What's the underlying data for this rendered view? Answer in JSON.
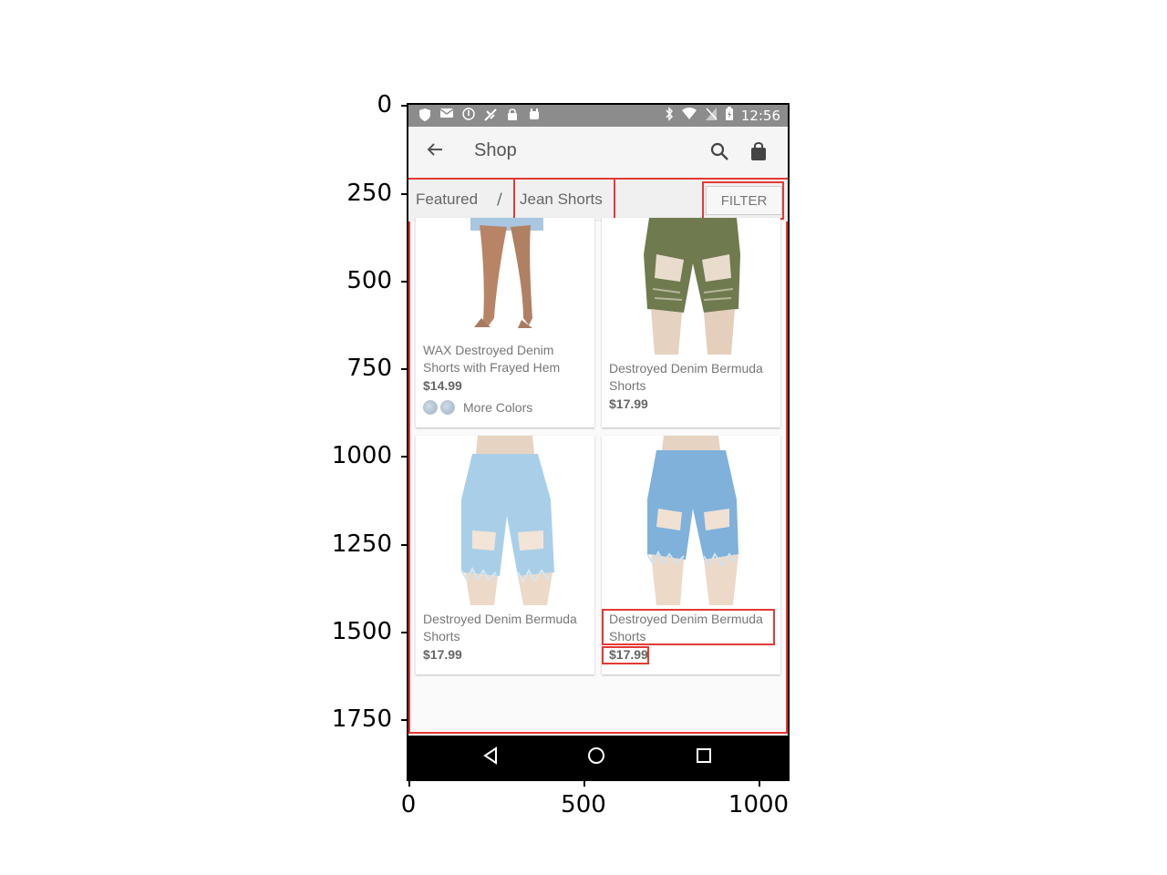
{
  "axes": {
    "y_ticks": [
      "0",
      "250",
      "500",
      "750",
      "1000",
      "1250",
      "1500",
      "1750"
    ],
    "x_ticks": [
      "0",
      "500",
      "1000"
    ]
  },
  "status_bar": {
    "time": "12:56",
    "left_icons": [
      "shield-icon",
      "email-icon",
      "info-icon",
      "sync-off-icon",
      "lock-icon",
      "android-icon"
    ],
    "right_icons": [
      "bluetooth-icon",
      "wifi-icon",
      "no-sim-icon",
      "battery-charging-icon"
    ]
  },
  "app_bar": {
    "title": "Shop",
    "back_icon": "arrow-back-icon",
    "search_icon": "search-icon",
    "bag_icon": "shopping-bag-icon"
  },
  "breadcrumb": {
    "parent": "Featured",
    "separator": "/",
    "current": "Jean Shorts",
    "filter_label": "FILTER"
  },
  "products": [
    {
      "name": "WAX Destroyed Denim Shorts with Frayed Hem",
      "price": "$14.99",
      "more_colors": "More Colors",
      "image": "legs-in-heels"
    },
    {
      "name": "Destroyed Denim Bermuda Shorts",
      "price": "$17.99",
      "image": "olive-bermuda-shorts"
    },
    {
      "name": "Destroyed Denim Bermuda Shorts",
      "price": "$17.99",
      "image": "light-blue-bermuda-shorts"
    },
    {
      "name": "Destroyed Denim Bermuda Shorts",
      "price": "$17.99",
      "image": "medium-blue-bermuda-shorts"
    }
  ],
  "nav_bar": [
    "back-triangle-icon",
    "home-circle-icon",
    "recents-square-icon"
  ],
  "colors": {
    "highlight": "#e53935",
    "status_bar": "#8c8c8c",
    "olive": "#6f7a4f",
    "light_denim": "#a9cfe8",
    "medium_denim": "#7fb1db"
  }
}
